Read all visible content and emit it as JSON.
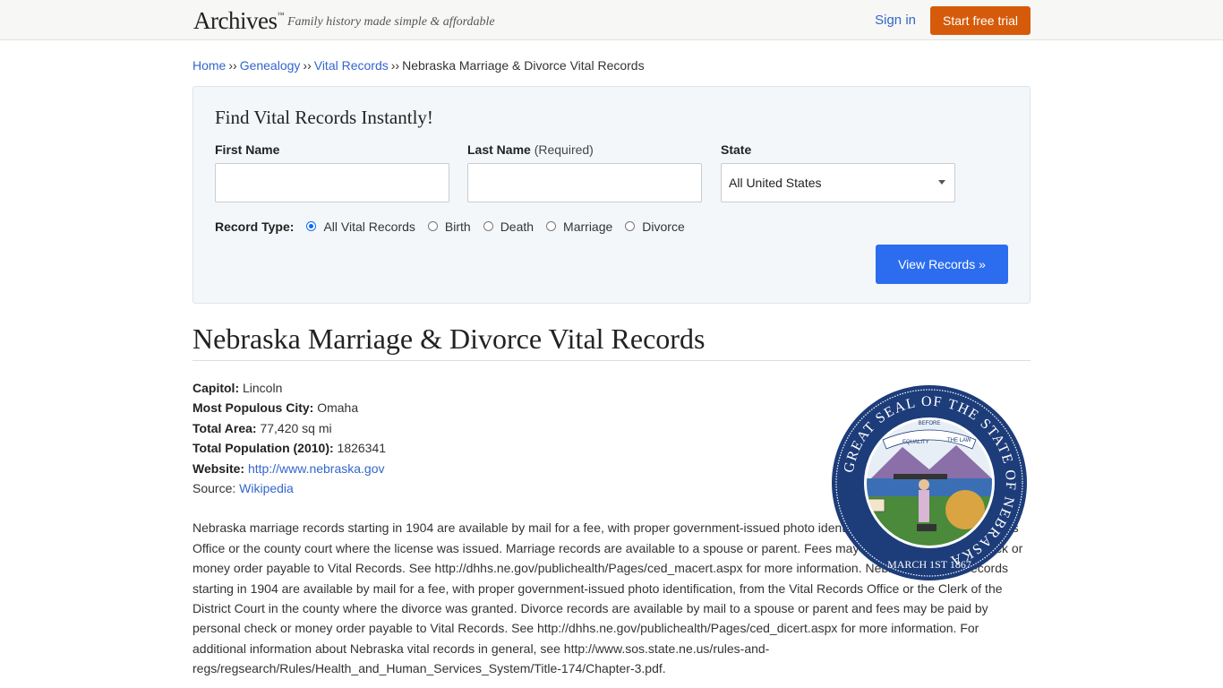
{
  "header": {
    "logo": "Archives",
    "logo_tm": "™",
    "tagline": "Family history made simple & affordable",
    "signin_label": "Sign in",
    "trial_label": "Start free trial"
  },
  "breadcrumb": {
    "items": [
      "Home",
      "Genealogy",
      "Vital Records"
    ],
    "separator": "››",
    "current": "Nebraska Marriage & Divorce Vital Records"
  },
  "search": {
    "title": "Find Vital Records Instantly!",
    "first_name_label": "First Name",
    "last_name_label": "Last Name",
    "last_name_req": "(Required)",
    "state_label": "State",
    "state_value": "All United States",
    "record_type_label": "Record Type:",
    "record_types": [
      "All Vital Records",
      "Birth",
      "Death",
      "Marriage",
      "Divorce"
    ],
    "selected_record_type": "All Vital Records",
    "submit_label": "View Records »"
  },
  "page": {
    "title": "Nebraska Marriage & Divorce Vital Records"
  },
  "facts": {
    "capitol_label": "Capitol:",
    "capitol": "Lincoln",
    "city_label": "Most Populous City:",
    "city": "Omaha",
    "area_label": "Total Area:",
    "area": "77,420 sq mi",
    "population_label": "Total Population (2010):",
    "population": "1826341",
    "website_label": "Website:",
    "website": "http://www.nebraska.gov",
    "source_label": "Source:",
    "source": "Wikipedia"
  },
  "seal": {
    "ring_text": "GREAT SEAL OF THE STATE OF NEBRASKA",
    "date": "MARCH 1ST 1867",
    "banner_equality": "EQUALITY",
    "banner_before": "BEFORE",
    "banner_law": "THE LAW"
  },
  "description": "Nebraska marriage records starting in 1904 are available by mail for a fee, with proper government-issued photo identification, from the Vital Records Office or the county court where the license was issued. Marriage records are available to a spouse or parent. Fees may be paid by personal check or money order payable to Vital Records. See http://dhhs.ne.gov/publichealth/Pages/ced_macert.aspx for more information. Nebraska divorce records starting in 1904 are available by mail for a fee, with proper government-issued photo identification, from the Vital Records Office or the Clerk of the District Court in the county where the divorce was granted. Divorce records are available by mail to a spouse or parent and fees may be paid by personal check or money order payable to Vital Records. See http://dhhs.ne.gov/publichealth/Pages/ced_dicert.aspx for more information. For additional information about Nebraska vital records in general, see http://www.sos.state.ne.us/rules-and-regs/regsearch/Rules/Health_and_Human_Services_System/Title-174/Chapter-3.pdf."
}
